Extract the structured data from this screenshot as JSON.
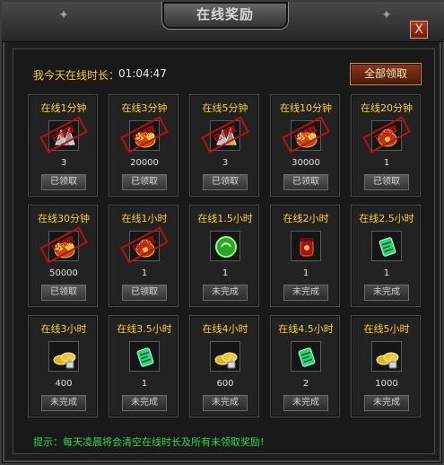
{
  "window": {
    "title": "在线奖励",
    "close_label": "X"
  },
  "header": {
    "online_label": "我今天在线时长：",
    "online_time": "01:04:47",
    "claim_all_label": "全部领取"
  },
  "rewards": [
    {
      "title": "在线1分钟",
      "qty": "3",
      "status": "已领取",
      "icon": "silver-ore-icon",
      "claimed": true,
      "stamp": "已领取"
    },
    {
      "title": "在线3分钟",
      "qty": "20000",
      "status": "已领取",
      "icon": "gold-coins-bag-icon",
      "claimed": true,
      "stamp": "已领取"
    },
    {
      "title": "在线5分钟",
      "qty": "3",
      "status": "已领取",
      "icon": "gem-ore-icon",
      "claimed": true,
      "stamp": "已领取"
    },
    {
      "title": "在线10分钟",
      "qty": "30000",
      "status": "已领取",
      "icon": "gold-coins-bag-icon",
      "claimed": true,
      "stamp": "已领取"
    },
    {
      "title": "在线20分钟",
      "qty": "1",
      "status": "已领取",
      "icon": "treasure-bag-icon",
      "claimed": true,
      "stamp": "已领取"
    },
    {
      "title": "在线30分钟",
      "qty": "50000",
      "status": "已领取",
      "icon": "gold-coins-bag-icon",
      "claimed": true,
      "stamp": "已领取"
    },
    {
      "title": "在线1小时",
      "qty": "1",
      "status": "已领取",
      "icon": "treasure-bag-icon",
      "claimed": true,
      "stamp": "已领取"
    },
    {
      "title": "在线1.5小时",
      "qty": "1",
      "status": "未完成",
      "icon": "green-orb-icon",
      "claimed": false,
      "stamp": ""
    },
    {
      "title": "在线2小时",
      "qty": "1",
      "status": "未完成",
      "icon": "red-jar-icon",
      "claimed": false,
      "stamp": ""
    },
    {
      "title": "在线2.5小时",
      "qty": "1",
      "status": "未完成",
      "icon": "green-scroll-icon",
      "claimed": false,
      "stamp": ""
    },
    {
      "title": "在线3小时",
      "qty": "400",
      "status": "未完成",
      "icon": "gold-ingot-lock-icon",
      "claimed": false,
      "stamp": ""
    },
    {
      "title": "在线3.5小时",
      "qty": "1",
      "status": "未完成",
      "icon": "green-scroll-icon",
      "claimed": false,
      "stamp": ""
    },
    {
      "title": "在线4小时",
      "qty": "600",
      "status": "未完成",
      "icon": "gold-ingot-lock-icon",
      "claimed": false,
      "stamp": ""
    },
    {
      "title": "在线4.5小时",
      "qty": "2",
      "status": "未完成",
      "icon": "green-scroll-icon",
      "claimed": false,
      "stamp": ""
    },
    {
      "title": "在线5小时",
      "qty": "1000",
      "status": "未完成",
      "icon": "gold-ingot-lock-icon",
      "claimed": false,
      "stamp": ""
    }
  ],
  "tip": "提示：每天凌晨将会清空在线时长及所有未领取奖励!",
  "colors": {
    "gold_text": "#ffcc33",
    "tip_green": "#35d84a",
    "stamp_red": "#c10f0f"
  }
}
